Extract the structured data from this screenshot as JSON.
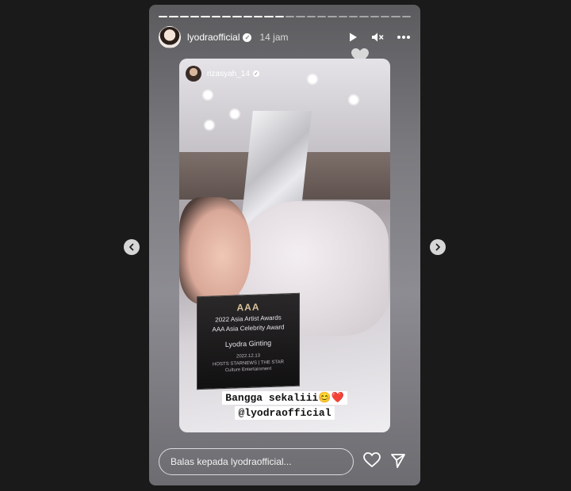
{
  "story": {
    "progress_total": 24,
    "progress_done": 12,
    "username": "lyodraofficial",
    "verified_mark": "✓",
    "time": "14 jam",
    "icons": [
      "play-icon",
      "mute-icon",
      "more-icon",
      "like-icon"
    ]
  },
  "repost": {
    "username": "rizasyah_14",
    "verified_mark": "✓"
  },
  "plaque": {
    "logo": "AAA",
    "line1": "2022 Asia Artist Awards",
    "line2": "AAA Asia Celebrity Award",
    "name": "Lyodra Ginting",
    "date": "2022.12.13",
    "sponsors": "HOSTS STARNEWS | THE STAR",
    "org": "Culture Entertainment"
  },
  "caption": {
    "line1": "Bangga sekaliii😊❤️",
    "line2": "@lyodraofficial"
  },
  "reply": {
    "placeholder": "Balas kepada lyodraofficial..."
  },
  "colors": {
    "background": "#1a1a1a",
    "story_bg": "#7a7a7f",
    "nav_button": "#d6d6d6"
  }
}
